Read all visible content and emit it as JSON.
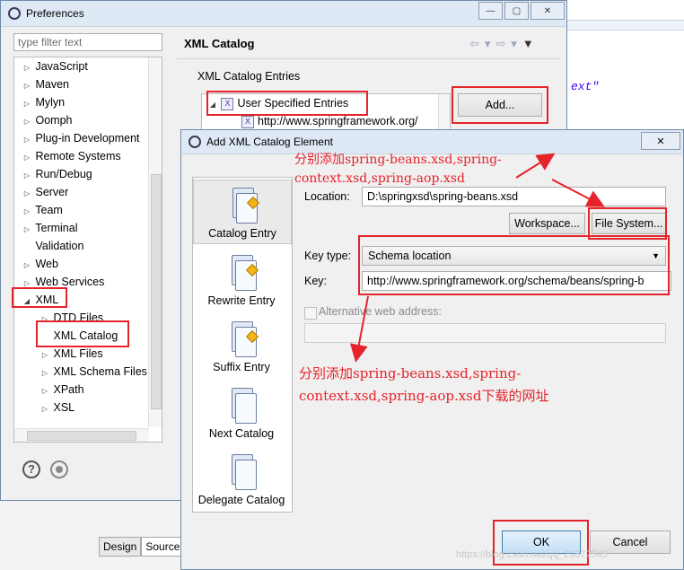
{
  "background": {
    "editor_snippet": "ext\"",
    "tabs": [
      "Design",
      "Source"
    ]
  },
  "preferences": {
    "title": "Preferences",
    "filter_placeholder": "type filter text",
    "tree": [
      {
        "label": "JavaScript",
        "expanded": false
      },
      {
        "label": "Maven",
        "expanded": false
      },
      {
        "label": "Mylyn",
        "expanded": false
      },
      {
        "label": "Oomph",
        "expanded": false
      },
      {
        "label": "Plug-in Development",
        "expanded": false
      },
      {
        "label": "Remote Systems",
        "expanded": false
      },
      {
        "label": "Run/Debug",
        "expanded": false
      },
      {
        "label": "Server",
        "expanded": false
      },
      {
        "label": "Team",
        "expanded": false
      },
      {
        "label": "Terminal",
        "expanded": false
      },
      {
        "label": "Validation",
        "expanded": null
      },
      {
        "label": "Web",
        "expanded": false
      },
      {
        "label": "Web Services",
        "expanded": false
      },
      {
        "label": "XML",
        "expanded": true
      },
      {
        "label": "DTD Files",
        "expanded": false
      },
      {
        "label": "XML Catalog",
        "expanded": null
      },
      {
        "label": "XML Files",
        "expanded": false
      },
      {
        "label": "XML Schema Files",
        "expanded": false
      },
      {
        "label": "XPath",
        "expanded": false
      },
      {
        "label": "XSL",
        "expanded": false
      }
    ],
    "page_title": "XML Catalog",
    "group_label": "XML Catalog Entries",
    "entries": [
      "User Specified Entries",
      "http://www.springframework.org/"
    ],
    "add_button": "Add..."
  },
  "dialog": {
    "title": "Add XML Catalog Element",
    "kinds": [
      "Catalog Entry",
      "Rewrite Entry",
      "Suffix Entry",
      "Next Catalog",
      "Delegate Catalog"
    ],
    "location_label": "Location:",
    "location_value": "D:\\springxsd\\spring-beans.xsd",
    "workspace_button": "Workspace...",
    "filesystem_button": "File System...",
    "keytype_label": "Key type:",
    "keytype_value": "Schema location",
    "key_label": "Key:",
    "key_value": "http://www.springframework.org/schema/beans/spring-b",
    "alt_label": "Alternative web address:",
    "ok_button": "OK",
    "cancel_button": "Cancel"
  },
  "annotations": {
    "note_top_line1": "分别添加spring-beans.xsd,spring-",
    "note_top_line2": "context.xsd,spring-aop.xsd",
    "note_mid_line1": "分别添加spring-beans.xsd,spring-",
    "note_mid_line2": "context.xsd,spring-aop.xsd下载的网址",
    "watermark": "https://blog.csdn.net/qq_29672545",
    "color": "#e5232b"
  }
}
